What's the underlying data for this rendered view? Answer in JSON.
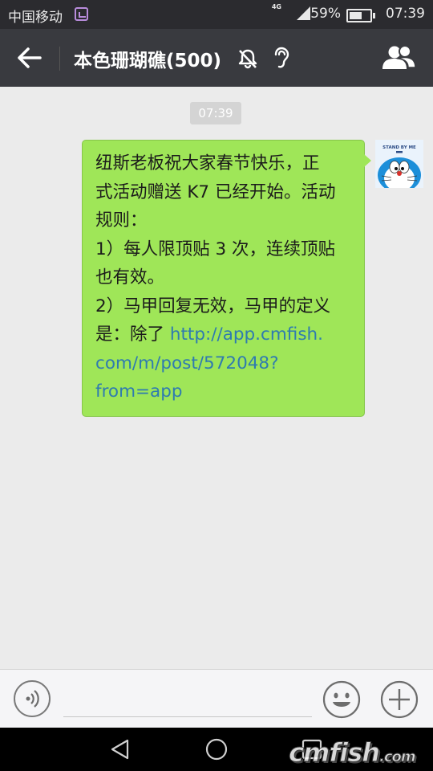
{
  "status_bar": {
    "carrier": "中国移动",
    "network": "4G",
    "battery": "59%",
    "battery_level": 0.59,
    "time": "07:39"
  },
  "header": {
    "title": "本色珊瑚礁(500)"
  },
  "chat": {
    "timestamp": "07:39",
    "messages": [
      {
        "sender": "self",
        "lines": [
          "纽斯老板祝大家春节快乐，正",
          "式活动赠送 K7 已经开始。活动",
          "规则：",
          "1）每人限顶贴 3 次，连续顶贴",
          "也有效。",
          "2）马甲回复无效，马甲的定义"
        ],
        "last_line_prefix": "是：除了 ",
        "link_part1": "http://app.cmfish.",
        "link_part2": "com/m/post/572048?",
        "link_part3": "from=app",
        "avatar_text": "STAND BY ME"
      }
    ]
  },
  "watermark": {
    "main": "cmfish",
    "suffix": ".com"
  },
  "colors": {
    "title_bar": "#393a3f",
    "bubble": "#9fe658",
    "link": "#2f7bb0",
    "chat_bg": "#ebebeb"
  },
  "icons": [
    "back-arrow-icon",
    "mute-bell-icon",
    "earpiece-icon",
    "group-members-icon",
    "voice-icon",
    "emoji-icon",
    "plus-icon",
    "nav-back-icon",
    "nav-home-icon",
    "nav-recent-icon"
  ]
}
